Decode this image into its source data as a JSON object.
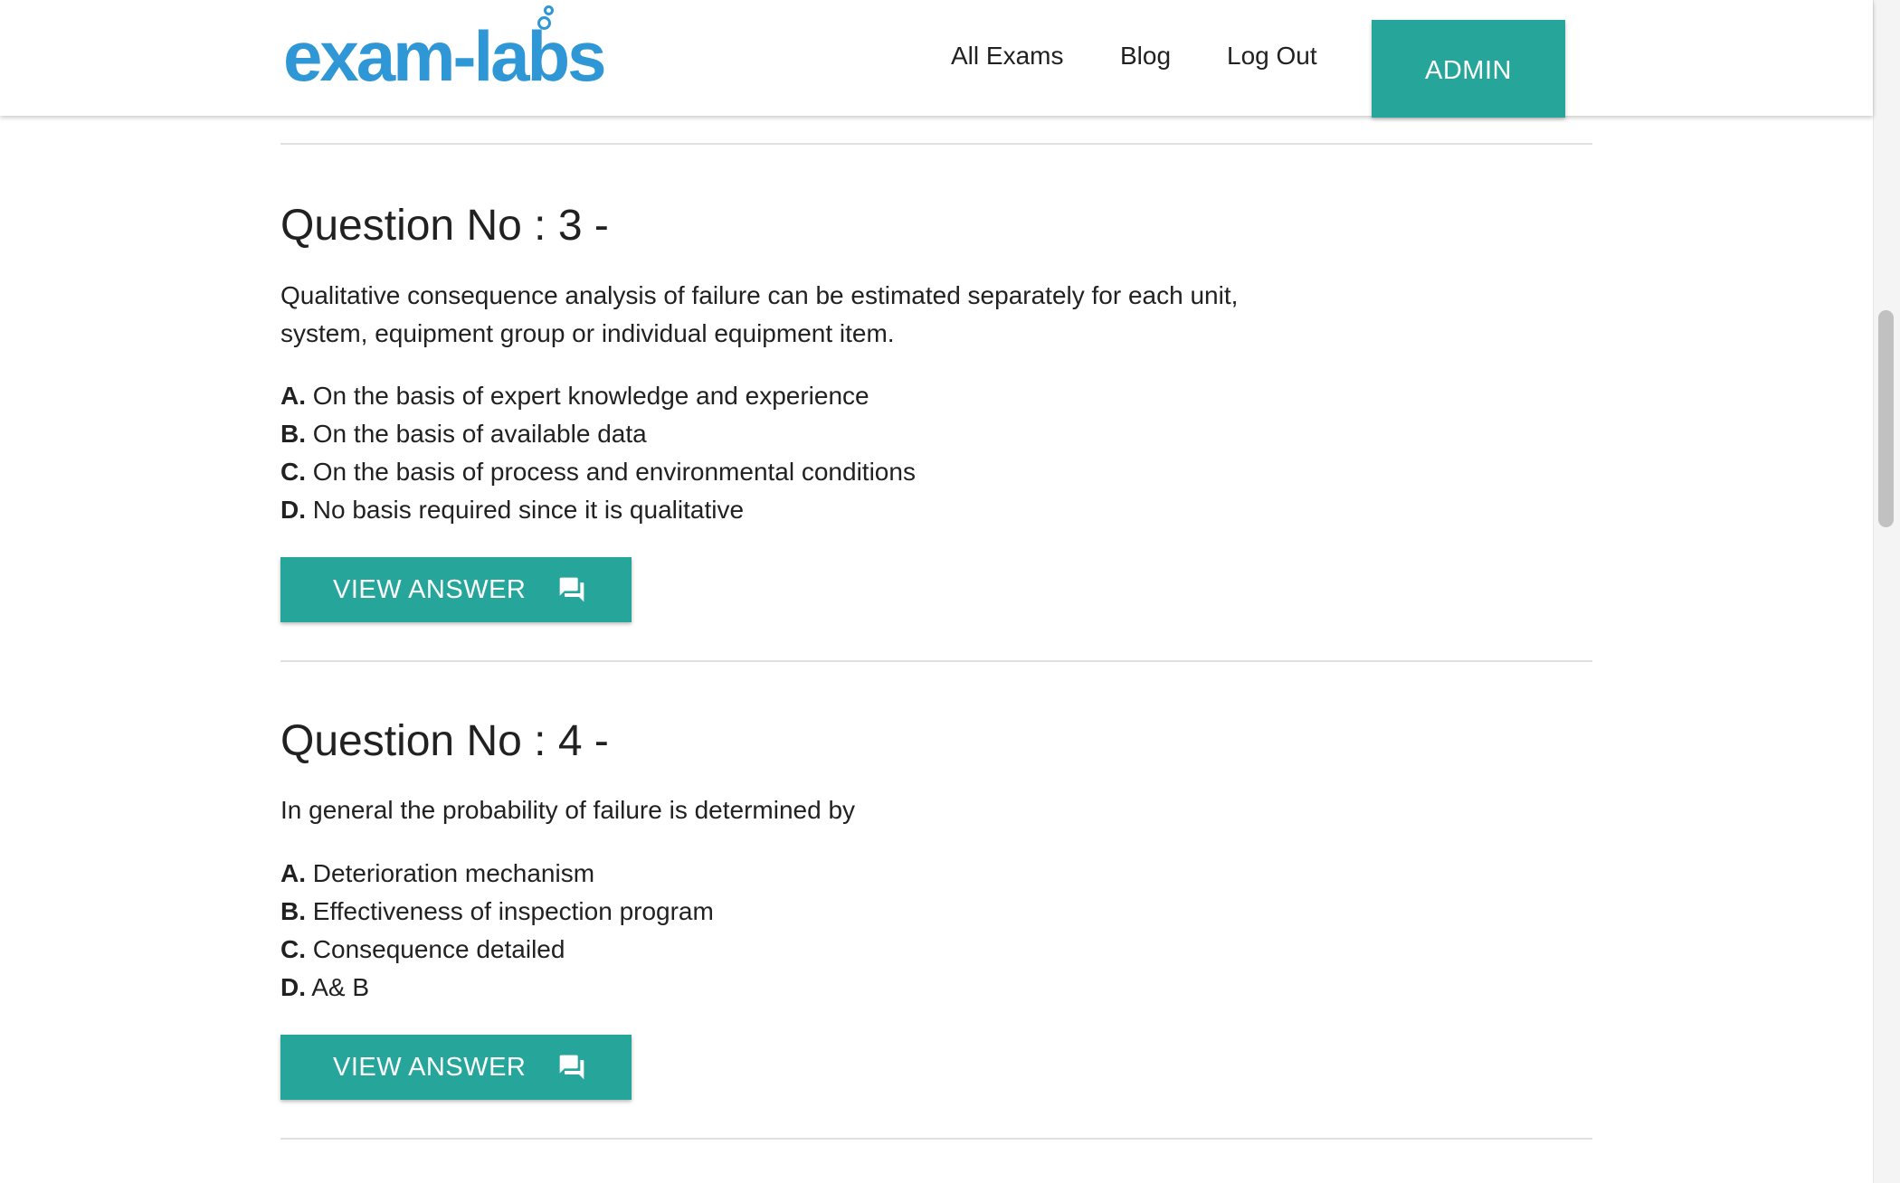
{
  "header": {
    "logo_text": "exam-labs",
    "nav": {
      "all_exams": "All Exams",
      "blog": "Blog",
      "log_out": "Log Out",
      "admin": "ADMIN"
    }
  },
  "questions": [
    {
      "title": "Question No : 3 -",
      "text": "Qualitative consequence analysis of failure can be estimated separately for each unit, system, equipment group or individual equipment item.",
      "options": [
        {
          "letter": "A.",
          "text": "On the basis of expert knowledge and experience"
        },
        {
          "letter": "B.",
          "text": "On the basis of available data"
        },
        {
          "letter": "C.",
          "text": "On the basis of process and environmental conditions"
        },
        {
          "letter": "D.",
          "text": "No basis required since it is qualitative"
        }
      ],
      "button_label": "VIEW ANSWER",
      "button_icon": "forum-icon"
    },
    {
      "title": "Question No : 4 -",
      "text": "In general the probability of failure is determined by",
      "options": [
        {
          "letter": "A.",
          "text": "Deterioration mechanism"
        },
        {
          "letter": "B.",
          "text": "Effectiveness of inspection program"
        },
        {
          "letter": "C.",
          "text": "Consequence detailed"
        },
        {
          "letter": "D.",
          "text": "A& B"
        }
      ],
      "button_label": "VIEW ANSWER",
      "button_icon": "forum-icon"
    }
  ],
  "colors": {
    "accent": "#26a69a",
    "logo": "#2f97d6",
    "text": "#212121",
    "divider": "#e0e0e0"
  }
}
